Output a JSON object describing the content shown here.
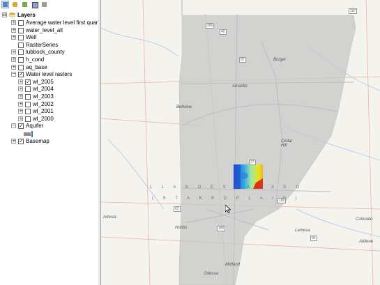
{
  "toc": {
    "toolbar_icons": [
      "list-by-drawing-order-icon",
      "list-by-source-icon",
      "list-by-visibility-icon",
      "list-by-selection-icon"
    ],
    "root": {
      "label": "Layers",
      "icon": "layers-folder-icon",
      "expander": "⊟"
    },
    "layers": [
      {
        "label": "Average water level first quarter (v",
        "checked": false,
        "expander": "+"
      },
      {
        "label": "water_level_all",
        "checked": false,
        "expander": "+"
      },
      {
        "label": "Well",
        "checked": false,
        "expander": "+"
      },
      {
        "label": "RasterSeries",
        "checked": false,
        "expander": ""
      },
      {
        "label": "lubbock_county",
        "checked": false,
        "expander": "+"
      },
      {
        "label": "h_cond",
        "checked": false,
        "expander": "+"
      },
      {
        "label": "aq_base",
        "checked": false,
        "expander": "+"
      },
      {
        "label": "Water level rasters",
        "checked": true,
        "expander": "−"
      },
      {
        "label": "wl_2005",
        "checked": true,
        "expander": "+",
        "child": true
      },
      {
        "label": "wl_2004",
        "checked": false,
        "expander": "+",
        "child": true
      },
      {
        "label": "wl_2003",
        "checked": false,
        "expander": "+",
        "child": true
      },
      {
        "label": "wl_2002",
        "checked": false,
        "expander": "+",
        "child": true
      },
      {
        "label": "wl_2001",
        "checked": false,
        "expander": "+",
        "child": true
      },
      {
        "label": "wl_2000",
        "checked": false,
        "expander": "+",
        "child": true
      },
      {
        "label": "Aquifer",
        "checked": true,
        "expander": "−"
      },
      {
        "label": "",
        "checked": null,
        "expander": "",
        "swatch": true
      },
      {
        "label": "Basemap",
        "checked": true,
        "expander": "+"
      }
    ],
    "check_glyph": "✓"
  },
  "map": {
    "cities": [
      "Amarillo",
      "Borger",
      "Bellview",
      "Cedar Hill",
      "Artesia",
      "Hobbs",
      "Midland",
      "Odessa",
      "Lamesa",
      "Colorado",
      "Abilene"
    ],
    "region_label_1": "L L A N O   E S T A C A D O",
    "region_label_2": "( S T A K E D   P L A I N )",
    "shields": [
      "287",
      "385",
      "40",
      "87",
      "27",
      "84",
      "180",
      "385",
      "84",
      "84",
      "62",
      "180"
    ],
    "colors": {
      "aquifer_fill": "#c8c8c8",
      "basemap_bg": "#f4f3ee",
      "road": "#e8b4a4",
      "water": "#a9c9e8",
      "raster_low": "#1f4fd1",
      "raster_high": "#e8e421",
      "raster_hot": "#e03214"
    }
  }
}
